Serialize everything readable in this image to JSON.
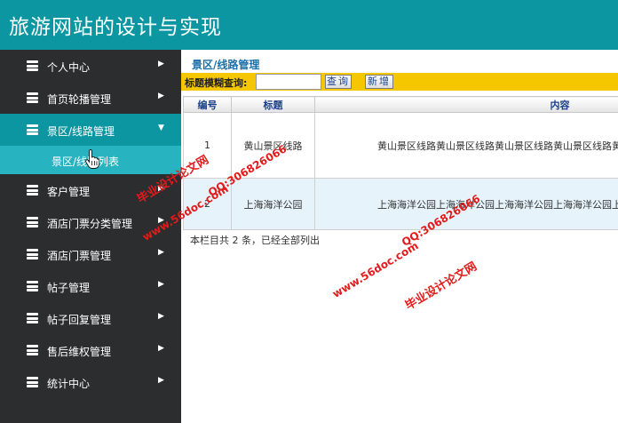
{
  "header": {
    "title": "旅游网站的设计与实现"
  },
  "sidebar": {
    "items": [
      {
        "label": "个人中心",
        "arrow": "▶"
      },
      {
        "label": "首页轮播管理",
        "arrow": "▶"
      },
      {
        "label": "景区/线路管理",
        "arrow": "▼",
        "active": true
      },
      {
        "label": "客户管理",
        "arrow": "▶"
      },
      {
        "label": "酒店门票分类管理",
        "arrow": "▶"
      },
      {
        "label": "酒店门票管理",
        "arrow": "▶"
      },
      {
        "label": "帖子管理",
        "arrow": "▶"
      },
      {
        "label": "帖子回复管理",
        "arrow": "▶"
      },
      {
        "label": "售后维权管理",
        "arrow": "▶"
      },
      {
        "label": "统计中心",
        "arrow": "▶"
      }
    ],
    "sub_item": {
      "label": "景区/线路列表"
    }
  },
  "main": {
    "breadcrumb": "景区/线路管理",
    "search": {
      "label": "标题模糊查询:",
      "value": "",
      "placeholder": ""
    },
    "buttons": {
      "query": "查询",
      "add": "新增"
    },
    "table": {
      "headers": [
        "编号",
        "标题",
        "内容"
      ],
      "rows": [
        {
          "id": "1",
          "title": "黄山景区线路",
          "content": "黄山景区线路黄山景区线路黄山景区线路黄山景区线路黄山景区线路"
        },
        {
          "id": "2",
          "title": "上海海洋公园",
          "content": "上海海洋公园上海海洋公园上海海洋公园上海海洋公园上海海洋公园"
        }
      ]
    },
    "footer": "本栏目共 2 条，已经全部列出"
  },
  "watermarks": {
    "site": "www.56doc.com",
    "qq": "QQ:306826066",
    "brand": "毕业设计论文网"
  },
  "colors": {
    "header_bg": "#0b96a2",
    "sidebar_bg": "#2b2d2f",
    "active_bg": "#0b96a2",
    "sub_bg": "#27b3bf",
    "toolbar_bg": "#f5c700",
    "watermark": "#e21b1b"
  }
}
